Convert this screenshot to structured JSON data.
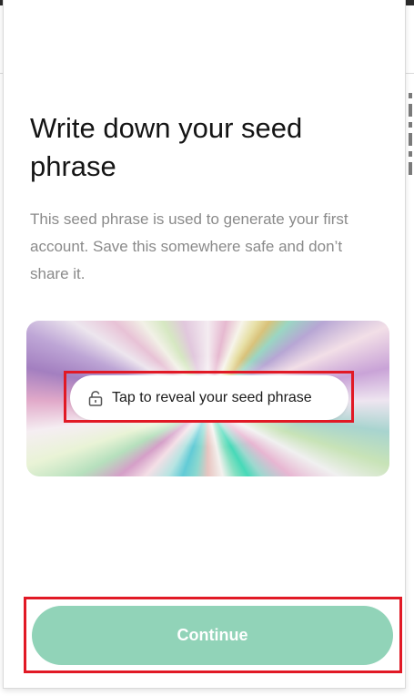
{
  "seed_screen": {
    "title": "Write down your seed phrase",
    "description": "This seed phrase is used to generate your first account. Save this somewhere safe and don’t share it.",
    "reveal": {
      "label": "Tap to reveal your seed phrase",
      "icon": "lock-icon"
    },
    "continue_label": "Continue"
  },
  "colors": {
    "title_text": "#141414",
    "description_text": "#8a8a8a",
    "continue_button_bg": "#91d3b8",
    "continue_button_text": "#ffffff",
    "highlight_border": "#e11925"
  }
}
